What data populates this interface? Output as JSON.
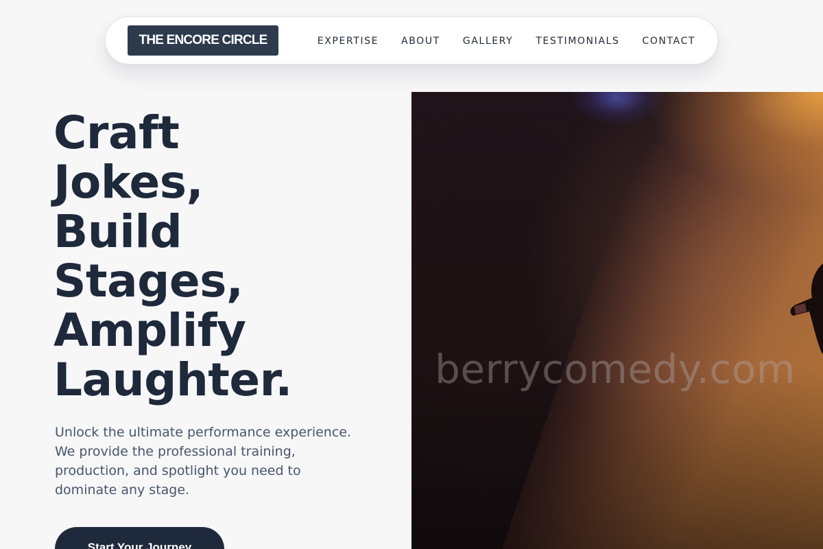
{
  "nav": {
    "logo": "THE ENCORE CIRCLE",
    "links": [
      {
        "label": "EXPERTISE"
      },
      {
        "label": "ABOUT"
      },
      {
        "label": "GALLERY"
      },
      {
        "label": "TESTIMONIALS"
      },
      {
        "label": "CONTACT"
      }
    ]
  },
  "hero": {
    "title_lines": [
      "Craft",
      "Jokes,",
      "Build",
      "Stages,",
      "Amplify",
      "Laughter."
    ],
    "description": "Unlock the ultimate performance experience. We provide the professional training, production, and spotlight you need to dominate any stage.",
    "cta_label": "Start Your Journey",
    "image": {
      "watermark": "berrycomedy.com",
      "colors": {
        "dark": "#1b1114",
        "spotlight": "#d08a40"
      }
    }
  },
  "colors": {
    "background": "#f7f7f8",
    "primary_dark": "#1e293b",
    "logo_bg": "#2d3b4d",
    "body_text": "#475569"
  }
}
